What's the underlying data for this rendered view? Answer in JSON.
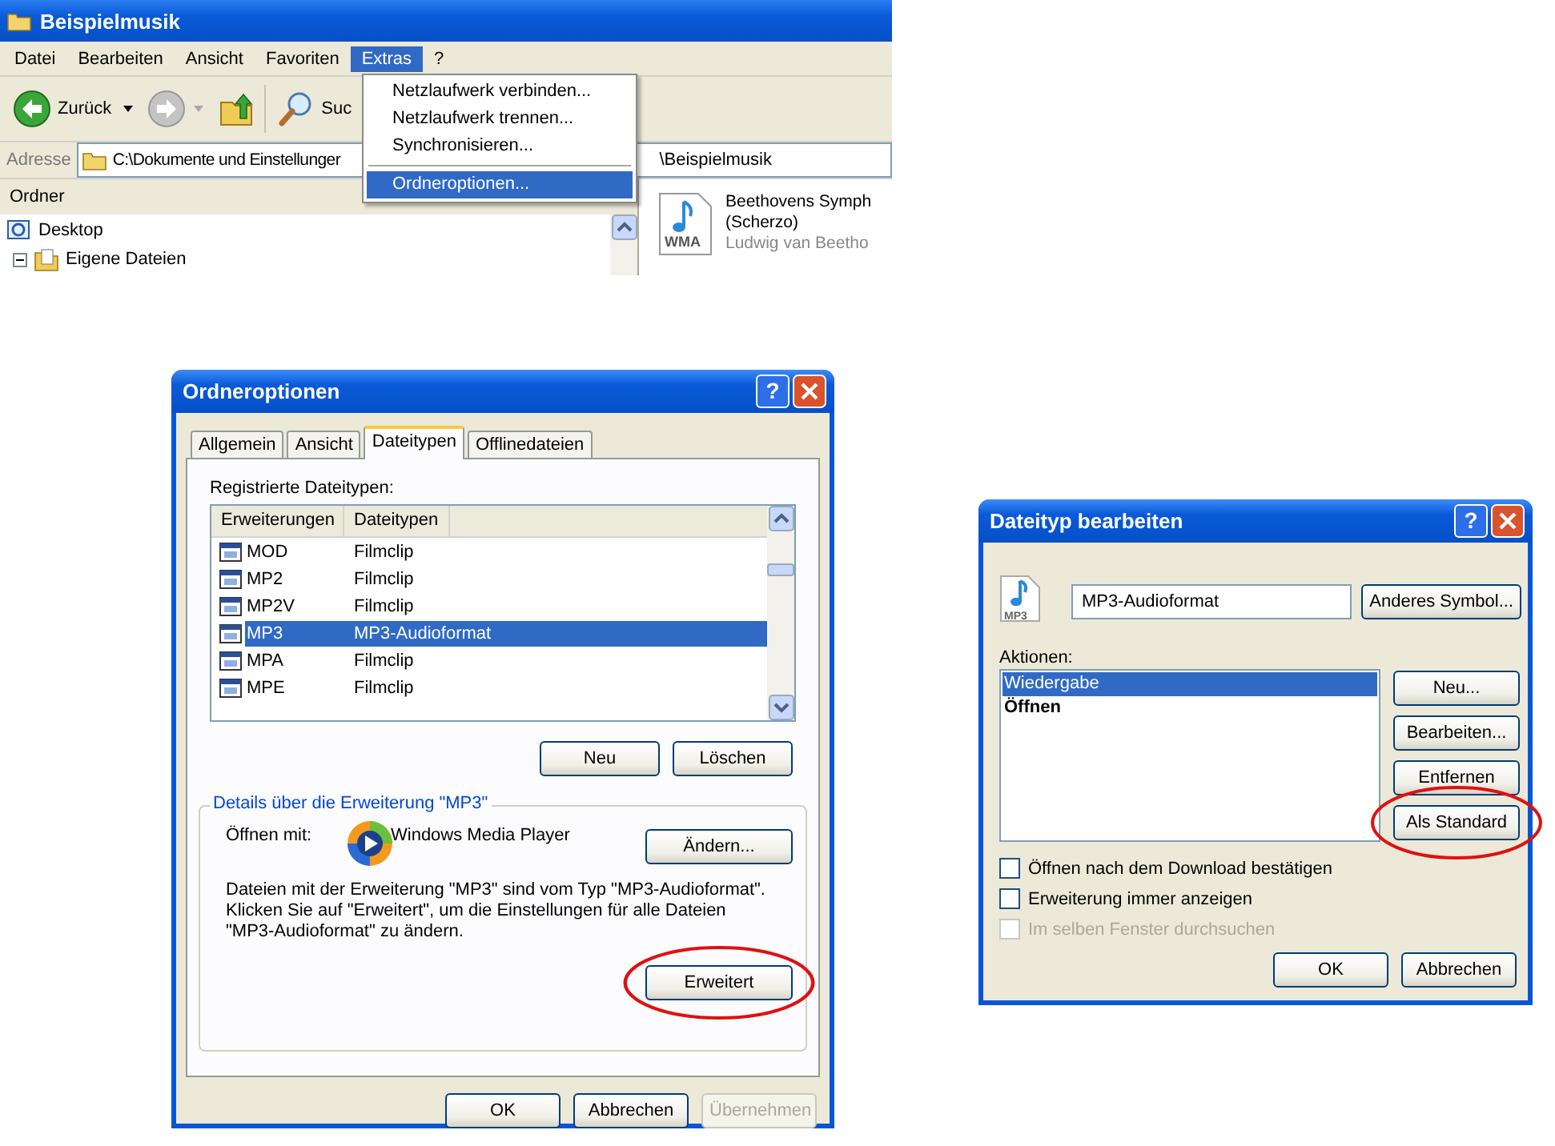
{
  "explorer": {
    "title": "Beispielmusik",
    "menu": [
      {
        "label": "Datei",
        "selected": false
      },
      {
        "label": "Bearbeiten",
        "selected": false
      },
      {
        "label": "Ansicht",
        "selected": false
      },
      {
        "label": "Favoriten",
        "selected": false
      },
      {
        "label": "Extras",
        "selected": true
      },
      {
        "label": "?",
        "selected": false
      }
    ],
    "toolbar": [
      {
        "kind": "back",
        "label": "Zurück"
      },
      {
        "kind": "forward"
      },
      {
        "kind": "up"
      },
      {
        "kind": "search",
        "label": "Suc"
      }
    ],
    "address_label": "Adresse",
    "address": "C:\\Dokumente und Einstellunger",
    "address_tail": "\\Beispielmusik",
    "folders_header": "Ordner",
    "tree": [
      {
        "label": "Desktop",
        "kind": "desktop",
        "children": [
          {
            "label": "Eigene Dateien",
            "kind": "documents",
            "expanded": true
          }
        ]
      }
    ],
    "files": [
      {
        "name": "Beethovens Symph",
        "subtitle": "(Scherzo)",
        "artist": "Ludwig van Beetho",
        "type": "WMA"
      }
    ],
    "extras_menu": [
      {
        "kind": "item",
        "label": "Netzlaufwerk verbinden...",
        "selected": false
      },
      {
        "kind": "item",
        "label": "Netzlaufwerk trennen...",
        "selected": false
      },
      {
        "kind": "item",
        "label": "Synchronisieren...",
        "selected": false
      },
      {
        "kind": "separator"
      },
      {
        "kind": "item",
        "label": "Ordneroptionen...",
        "selected": true
      }
    ]
  },
  "folder_options": {
    "title": "Ordneroptionen",
    "help": "?",
    "tabs": [
      {
        "label": "Allgemein",
        "selected": false
      },
      {
        "label": "Ansicht",
        "selected": false
      },
      {
        "label": "Dateitypen",
        "selected": true
      },
      {
        "label": "Offlinedateien",
        "selected": false
      }
    ],
    "list_label": "Registrierte Dateitypen:",
    "columns": [
      "Erweiterungen",
      "Dateitypen"
    ],
    "rows": [
      {
        "extension": "MOD",
        "type": "Filmclip",
        "selected": false
      },
      {
        "extension": "MP2",
        "type": "Filmclip",
        "selected": false
      },
      {
        "extension": "MP2V",
        "type": "Filmclip",
        "selected": false
      },
      {
        "extension": "MP3",
        "type": "MP3-Audioformat",
        "selected": true
      },
      {
        "extension": "MPA",
        "type": "Filmclip",
        "selected": false
      },
      {
        "extension": "MPE",
        "type": "Filmclip",
        "selected": false
      }
    ],
    "list_buttons": [
      {
        "label": "Neu",
        "highlighted": false
      },
      {
        "label": "Löschen",
        "highlighted": false
      }
    ],
    "details": {
      "title": "Details über die Erweiterung \"MP3\"",
      "open_with_label": "Öffnen mit:",
      "program": "Windows Media Player",
      "change_button": {
        "label": "Ändern...",
        "highlighted": false
      },
      "description": "Dateien mit der Erweiterung \"MP3\" sind vom Typ \"MP3-Audioformat\". Klicken Sie auf \"Erweitert\", um die Einstellungen für alle Dateien \"MP3-Audioformat\" zu ändern.",
      "advanced_button": {
        "label": "Erweitert",
        "highlighted": true
      }
    },
    "buttons": [
      {
        "label": "OK",
        "disabled": false
      },
      {
        "label": "Abbrechen",
        "disabled": false
      },
      {
        "label": "Übernehmen",
        "disabled": true
      }
    ]
  },
  "edit_type": {
    "title": "Dateityp bearbeiten",
    "help": "?",
    "icon_type": "MP3",
    "type_name": "MP3-Audioformat",
    "change_icon_button": "Anderes Symbol...",
    "actions_label": "Aktionen:",
    "actions": [
      {
        "label": "Wiedergabe",
        "selected": true,
        "default": false
      },
      {
        "label": "Öffnen",
        "selected": false,
        "default": true
      }
    ],
    "action_buttons": [
      {
        "label": "Neu...",
        "highlighted": false
      },
      {
        "label": "Bearbeiten...",
        "highlighted": false
      },
      {
        "label": "Entfernen",
        "highlighted": false
      },
      {
        "label": "Als Standard",
        "highlighted": true
      }
    ],
    "checkboxes": [
      {
        "label": "Öffnen nach dem Download bestätigen",
        "checked": false,
        "disabled": false
      },
      {
        "label": "Erweiterung immer anzeigen",
        "checked": false,
        "disabled": false
      },
      {
        "label": "Im selben Fenster durchsuchen",
        "checked": false,
        "disabled": true
      }
    ],
    "buttons": [
      {
        "label": "OK",
        "disabled": false
      },
      {
        "label": "Abbrechen",
        "disabled": false
      }
    ]
  }
}
